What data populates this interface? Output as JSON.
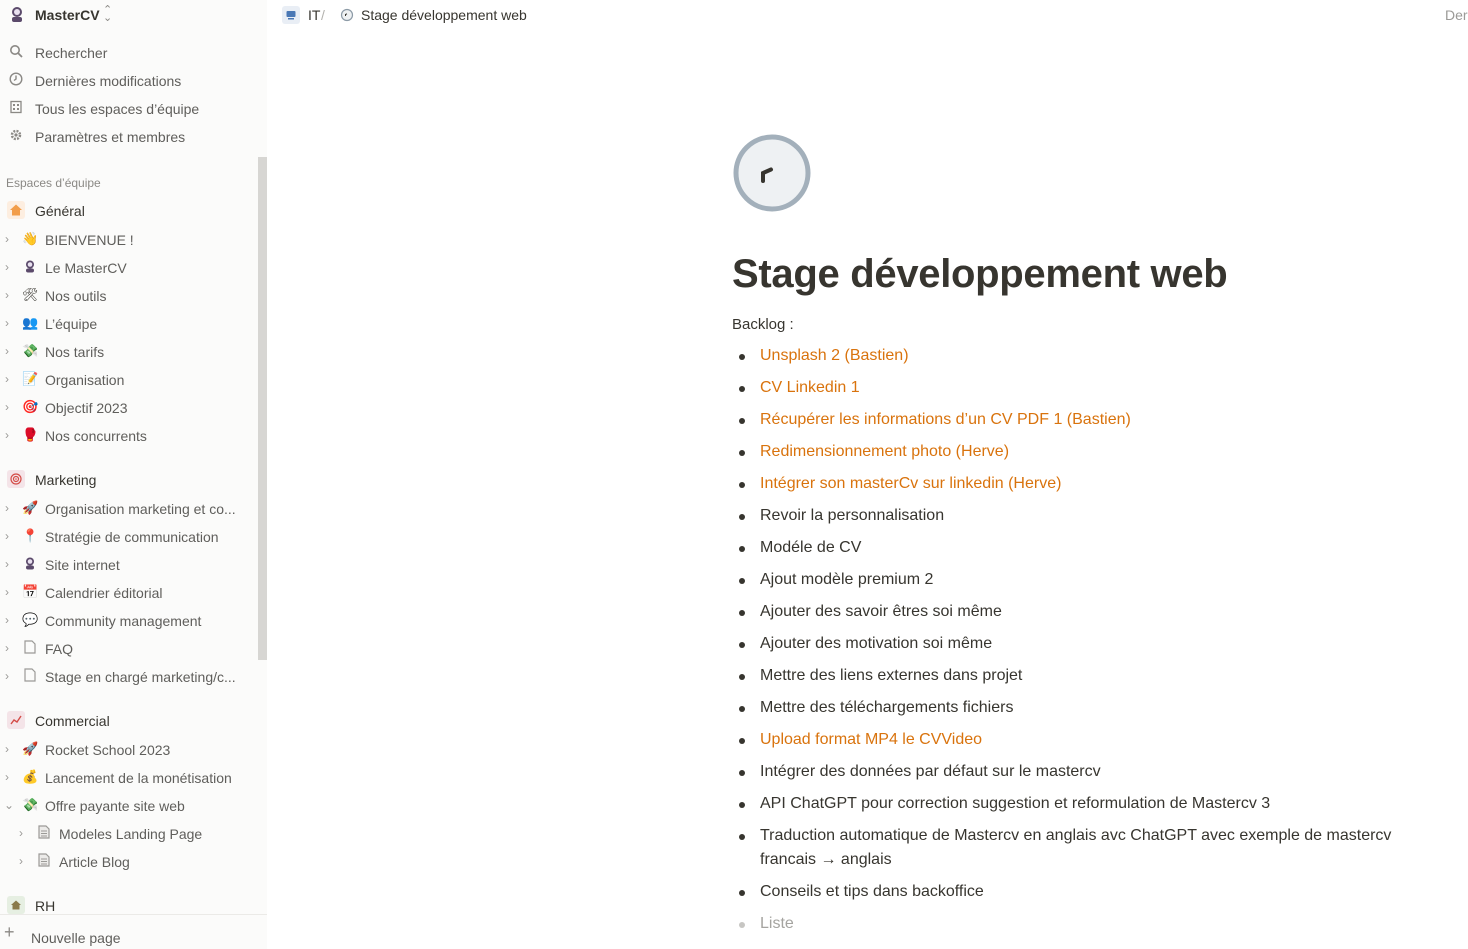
{
  "workspace": {
    "name": "MasterCV",
    "avatar": "astronaut-emoji"
  },
  "sidebar": {
    "top_items": [
      {
        "label": "Rechercher",
        "icon": "search-icon"
      },
      {
        "label": "Dernières modifications",
        "icon": "clock-icon"
      },
      {
        "label": "Tous les espaces d’équipe",
        "icon": "building-icon"
      },
      {
        "label": "Paramètres et membres",
        "icon": "gear-icon"
      }
    ],
    "section_label": "Espaces d’équipe",
    "teams": [
      {
        "name": "Général",
        "icon": "house-icon",
        "icon_color": "#f29d49",
        "pages": [
          {
            "label": "BIENVENUE !",
            "emoji": "👋"
          },
          {
            "label": "Le MasterCV",
            "emoji": "🧑"
          },
          {
            "label": "Nos outils",
            "emoji": "🛠"
          },
          {
            "label": "L’équipe",
            "emoji": "👥"
          },
          {
            "label": "Nos tarifs",
            "emoji": "💸"
          },
          {
            "label": "Organisation",
            "emoji": "📝"
          },
          {
            "label": "Objectif 2023",
            "emoji": "🎯"
          },
          {
            "label": "Nos concurrents",
            "emoji": "🥊"
          }
        ]
      },
      {
        "name": "Marketing",
        "icon": "target-icon",
        "icon_color": "#f1e1e6",
        "pages": [
          {
            "label": "Organisation marketing et co...",
            "emoji": "🚀"
          },
          {
            "label": "Stratégie de communication",
            "emoji": "📍"
          },
          {
            "label": "Site internet",
            "emoji": "🧑"
          },
          {
            "label": "Calendrier éditorial",
            "emoji": "📅"
          },
          {
            "label": "Community management",
            "emoji": "💬"
          },
          {
            "label": "FAQ",
            "emoji": "🗋"
          },
          {
            "label": "Stage en chargé marketing/c...",
            "emoji": "🗋"
          }
        ]
      },
      {
        "name": "Commercial",
        "icon": "chart-icon",
        "icon_color": "#f1e1e6",
        "pages": [
          {
            "label": "Rocket School 2023",
            "emoji": "🚀"
          },
          {
            "label": "Lancement de la monétisation",
            "emoji": "💰"
          },
          {
            "label": "Offre payante site web",
            "emoji": "💸",
            "expanded": true
          },
          {
            "label": "Modeles Landing Page",
            "emoji": "🗎",
            "indent": true
          },
          {
            "label": "Article Blog",
            "emoji": "🗎",
            "indent": true
          }
        ]
      },
      {
        "name": "RH",
        "icon": "house-small-icon",
        "icon_color": "#e6efe2",
        "pages": []
      }
    ],
    "new_page_label": "Nouvelle page"
  },
  "topbar": {
    "breadcrumb": [
      {
        "label": "IT",
        "icon": "computer-icon"
      },
      {
        "label": "Stage développement web",
        "icon": "clock-icon"
      }
    ],
    "separator": "/",
    "right_text": "Der"
  },
  "page": {
    "title": "Stage développement web",
    "icon": "clock-icon",
    "intro": "Backlog :",
    "items": [
      {
        "text": "Unsplash 2 (Bastien)",
        "type": "link"
      },
      {
        "text": "CV Linkedin 1",
        "type": "link"
      },
      {
        "text": "Récupérer les informations d’un CV PDF 1 (Bastien)",
        "type": "link"
      },
      {
        "text": "Redimensionnement photo (Herve)",
        "type": "link"
      },
      {
        "text": "Intégrer son masterCv sur linkedin  (Herve)",
        "type": "link"
      },
      {
        "text": "Revoir la personnalisation",
        "type": "text"
      },
      {
        "text": "Modéle de CV",
        "type": "text"
      },
      {
        "text": "Ajout modèle premium 2",
        "type": "text"
      },
      {
        "text": "Ajouter des savoir êtres soi même",
        "type": "text"
      },
      {
        "text": "Ajouter des motivation soi même",
        "type": "text"
      },
      {
        "text": "Mettre des liens externes dans projet",
        "type": "text"
      },
      {
        "text": "Mettre des téléchargements fichiers",
        "type": "text"
      },
      {
        "text": "Upload format MP4 le CVVideo",
        "type": "link"
      },
      {
        "text": "Intégrer des données par défaut sur le mastercv",
        "type": "text"
      },
      {
        "text": "API ChatGPT pour correction suggestion et reformulation de Mastercv 3",
        "type": "text"
      },
      {
        "text": "Traduction automatique de Mastercv en anglais avc ChatGPT avec exemple de mastercv francais → anglais",
        "type": "text"
      },
      {
        "text": "Conseils et tips dans backoffice",
        "type": "text"
      },
      {
        "text": "Liste",
        "type": "placeholder"
      }
    ]
  },
  "colors": {
    "link": "#d9730d",
    "text": "#37352f",
    "sidebar_bg": "#fbfbfa",
    "muted": "#8b8985"
  }
}
